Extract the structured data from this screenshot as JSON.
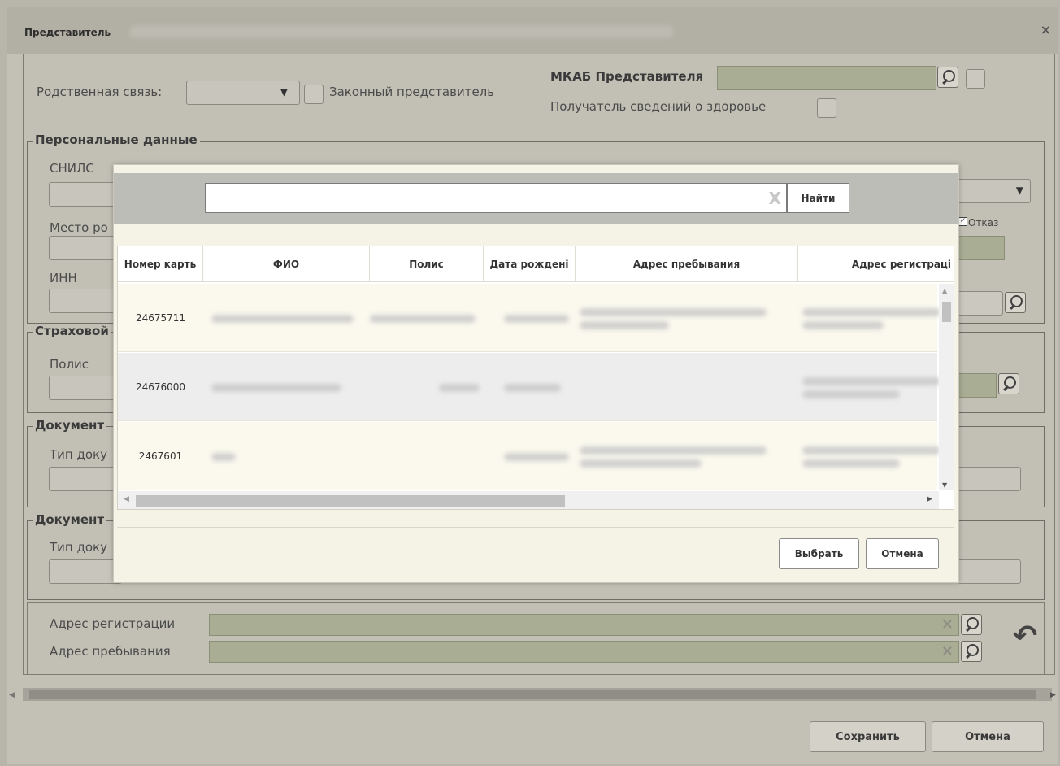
{
  "window": {
    "title": "Представитель",
    "close": "×"
  },
  "top": {
    "relation_label": "Родственная связь:",
    "relation_arrow": "▼",
    "legal_rep_label": "Законный представитель",
    "mkab_label": "МКАБ Представителя",
    "health_info_label": "Получатель сведений о здоровье"
  },
  "personal": {
    "legend": "Персональные данные",
    "snils_label": "СНИЛС",
    "birthplace_label": "Место ро",
    "inn_label": "ИНН",
    "refusal_label": "Отказ",
    "dropdown_arrow": "▼"
  },
  "insurance": {
    "legend": "Страховой",
    "policy_label": "Полис"
  },
  "doc1": {
    "legend": "Документ",
    "type_label": "Тип доку"
  },
  "doc2": {
    "legend": "Документ",
    "type_label": "Тип доку"
  },
  "address": {
    "reg_label": "Адрес регистрации",
    "stay_label": "Адрес пребывания",
    "clear_glyph": "×",
    "undo_glyph": "↶"
  },
  "footer": {
    "save_label": "Сохранить",
    "cancel_label": "Отмена"
  },
  "modal": {
    "search_value": "",
    "search_clear": "X",
    "find_label": "Найти",
    "columns": [
      "Номер карть",
      "ФИО",
      "Полис",
      "Дата рождені",
      "Адрес пребывания",
      "Адрес регистраці"
    ],
    "rows": [
      {
        "number": "24675711"
      },
      {
        "number": "24676000"
      },
      {
        "number": "2467601"
      }
    ],
    "select_label": "Выбрать",
    "cancel_label": "Отмена"
  }
}
